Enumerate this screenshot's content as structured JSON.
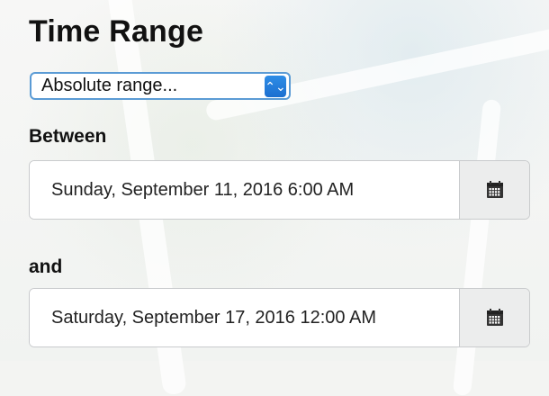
{
  "panel": {
    "title": "Time Range",
    "range_select": {
      "selected": "Absolute range..."
    },
    "between_label": "Between",
    "and_label": "and",
    "start_date": {
      "value": "Sunday, September 11, 2016 6:00 AM"
    },
    "end_date": {
      "value": "Saturday, September 17, 2016 12:00 AM"
    }
  },
  "icons": {
    "select_arrows": "select-arrows-icon",
    "calendar": "calendar-icon"
  },
  "colors": {
    "select_border": "#5b9bd5",
    "select_button": "#1c6fd0",
    "input_border": "#c9cbcd",
    "calendar_button_bg": "#eceded"
  }
}
